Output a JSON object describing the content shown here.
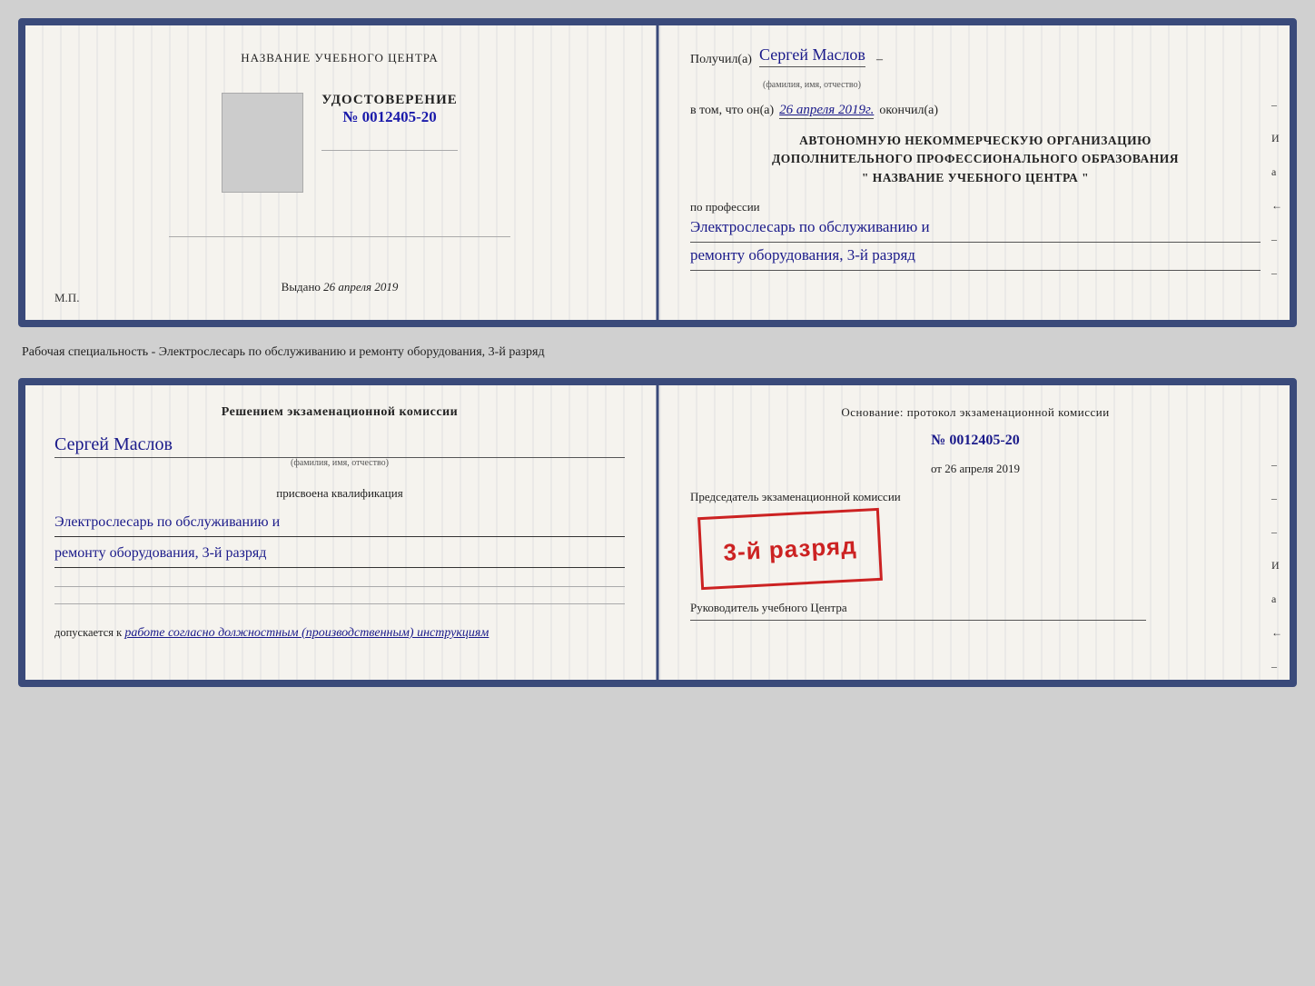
{
  "card1": {
    "left": {
      "school_title": "НАЗВАНИЕ УЧЕБНОГО ЦЕНТРА",
      "cert_label": "УДОСТОВЕРЕНИЕ",
      "cert_number": "№ 0012405-20",
      "issued_prefix": "Выдано",
      "issued_date": "26 апреля 2019",
      "mp_label": "М.П."
    },
    "right": {
      "recipient_prefix": "Получил(а)",
      "recipient_name": "Сергей Маслов",
      "recipient_sublabel": "(фамилия, имя, отчество)",
      "date_prefix": "в том, что он(а)",
      "date_value": "26 апреля 2019г.",
      "date_suffix": "окончил(а)",
      "org_line1": "АВТОНОМНУЮ НЕКОММЕРЧЕСКУЮ ОРГАНИЗАЦИЮ",
      "org_line2": "ДОПОЛНИТЕЛЬНОГО ПРОФЕССИОНАЛЬНОГО ОБРАЗОВАНИЯ",
      "org_line3": "\"  НАЗВАНИЕ УЧЕБНОГО ЦЕНТРА  \"",
      "profession_prefix": "по профессии",
      "profession_line1": "Электрослесарь по обслуживанию и",
      "profession_line2": "ремонту оборудования, 3-й разряд"
    }
  },
  "between_label": "Рабочая специальность - Электрослесарь по обслуживанию и ремонту оборудования, 3-й разряд",
  "card2": {
    "left": {
      "commission_title": "Решением экзаменационной комиссии",
      "name": "Сергей Маслов",
      "name_sublabel": "(фамилия, имя, отчество)",
      "qualification_prefix": "присвоена квалификация",
      "qualification_line1": "Электрослесарь по обслуживанию и",
      "qualification_line2": "ремонту оборудования, 3-й разряд",
      "dopusk_prefix": "допускается к",
      "dopusk_text": "работе согласно должностным (производственным) инструкциям"
    },
    "right": {
      "osnov_label": "Основание: протокол экзаменационной комиссии",
      "protocol_number": "№  0012405-20",
      "protocol_date_prefix": "от",
      "protocol_date": "26 апреля 2019",
      "chairman_label": "Председатель экзаменационной комиссии",
      "stamp_text": "3-й разряд",
      "rukov_label": "Руководитель учебного Центра"
    }
  },
  "right_marks": [
    "И",
    "а",
    "←",
    "–",
    "–",
    "–"
  ]
}
